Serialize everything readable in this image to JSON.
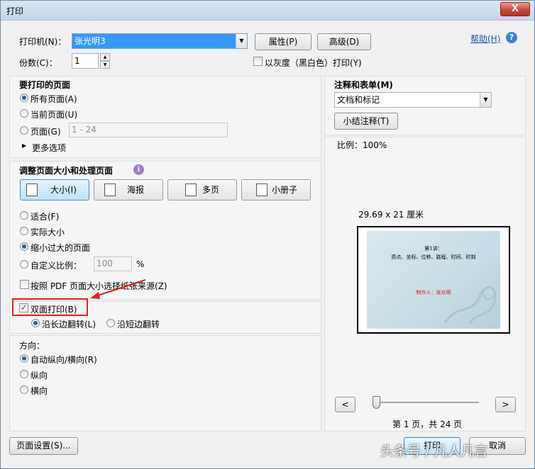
{
  "window": {
    "title": "打印",
    "close_label": "X"
  },
  "top": {
    "printer_label": "打印机(N)：",
    "printer_value": "张光明3",
    "properties_button": "属性(P)",
    "advanced_button": "高级(D)",
    "help_link": "帮助(H)",
    "copies_label": "份数(C)：",
    "copies_value": "1",
    "grayscale_label": "以灰度（黑白色）打印(Y)"
  },
  "pages_section": {
    "title": "要打印的页面",
    "all_pages": "所有页面(A)",
    "current_page": "当前页面(U)",
    "pages": "页面(G)",
    "pages_value": "1 - 24",
    "more_options": "更多选项"
  },
  "sizing_section": {
    "title": "调整页面大小和处理页面",
    "tabs": [
      "大小(I)",
      "海报",
      "多页",
      "小册子"
    ],
    "fit": "适合(F)",
    "actual_size": "实际大小",
    "shrink_oversized": "缩小过大的页面",
    "custom_scale": "自定义比例：",
    "custom_scale_value": "100",
    "percent": "%",
    "choose_paper_source": "按照 PDF 页面大小选择纸张来源(Z)"
  },
  "duplex": {
    "label": "双面打印(B)",
    "long_edge": "沿长边翻转(L)",
    "short_edge": "沿短边翻转"
  },
  "orientation": {
    "title": "方向：",
    "auto": "自动纵向/横向(R)",
    "portrait": "纵向",
    "landscape": "横向"
  },
  "comments": {
    "title": "注释和表单(M)",
    "value": "文档和标记",
    "summarize_button": "小结注释(T)"
  },
  "preview": {
    "scale": "比例：100%",
    "paper_size": "29.69 x 21 厘米",
    "page_title": "第1讲：",
    "page_subtitle": "质点、坐标、位移、路程、时间、时刻",
    "page_author": "制作人：张光明",
    "prev": "<",
    "next": ">",
    "page_status": "第 1 页，共 24 页"
  },
  "footer": {
    "page_setup_button": "页面设置(S)...",
    "print_button": "打印",
    "cancel_button": "取消"
  },
  "watermark": "头条号 / 凡人凡言",
  "colors": {
    "selection": "#3399ff",
    "highlight": "#e02020"
  }
}
